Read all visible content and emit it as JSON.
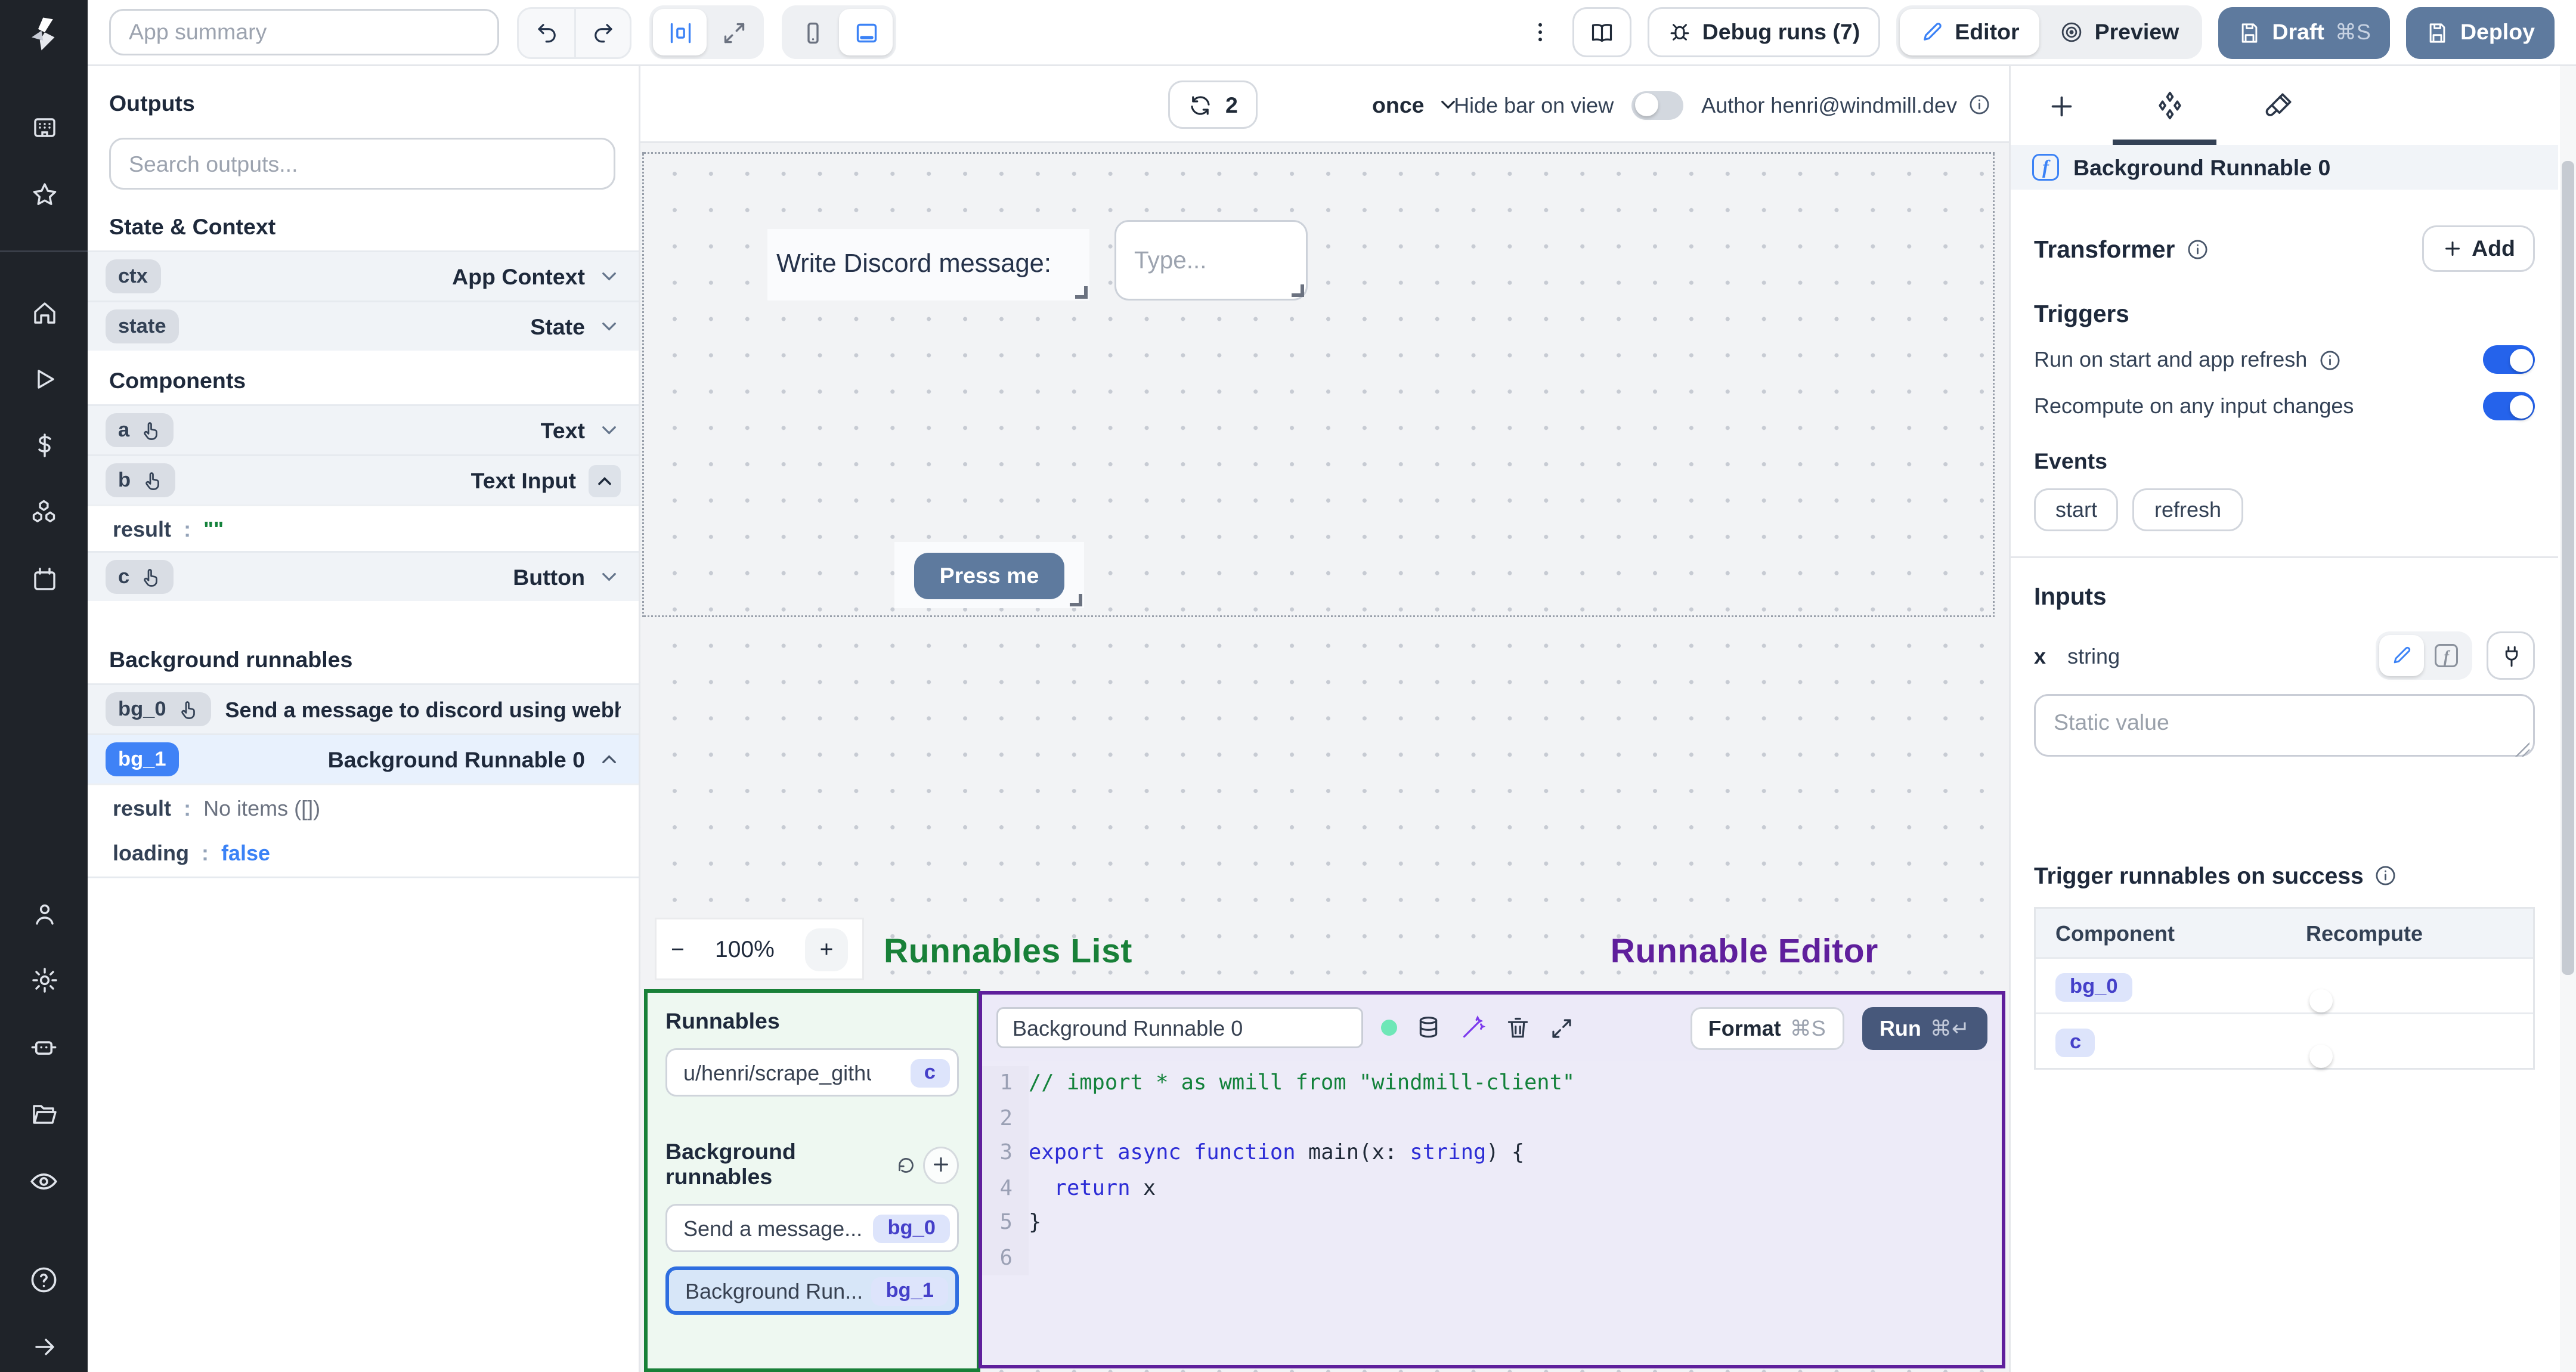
{
  "colors": {
    "accent-blue": "#3b82f6",
    "toggle-on": "#2563eb",
    "slate-btn": "#5e7a9e",
    "run-btn": "#47587b",
    "annotation-green": "#188038",
    "annotation-purple": "#5f1f9c",
    "badge-indigo-text": "#4540c9",
    "code-keyword": "#2d2dd6",
    "code-comment": "#13823b"
  },
  "topbar": {
    "app_summary_placeholder": "App summary",
    "debug_runs_label": "Debug runs (7)",
    "editor_label": "Editor",
    "preview_label": "Preview",
    "draft_label": "Draft",
    "draft_shortcut": "⌘S",
    "deploy_label": "Deploy"
  },
  "canvas_toolbar": {
    "refresh_count": "2",
    "frequency": "once",
    "hide_bar_label": "Hide bar on view",
    "author_label": "Author henri@windmill.dev"
  },
  "outputs": {
    "title": "Outputs",
    "search_placeholder": "Search outputs...",
    "state_context_title": "State & Context",
    "ctx": {
      "key": "ctx",
      "type": "App Context"
    },
    "state": {
      "key": "state",
      "type": "State"
    },
    "components_title": "Components",
    "comp_a": {
      "key": "a",
      "type": "Text"
    },
    "comp_b": {
      "key": "b",
      "type": "Text Input"
    },
    "b_result_key": "result",
    "b_result_value": "\"\"",
    "comp_c": {
      "key": "c",
      "type": "Button"
    },
    "background_title": "Background runnables",
    "bg0": {
      "key": "bg_0",
      "label": "Send a message to discord using webhoo"
    },
    "bg1": {
      "key": "bg_1",
      "label": "Background Runnable 0"
    },
    "bg1_result_key": "result",
    "bg1_result_value": "No items ([])",
    "bg1_loading_key": "loading",
    "bg1_loading_value": "false"
  },
  "canvas": {
    "text_component": "Write Discord message:",
    "input_placeholder": "Type...",
    "button_label": "Press me",
    "zoom_value": "100%",
    "zoom_out": "−",
    "zoom_in": "+"
  },
  "annotations": {
    "runnables_list": "Runnables List",
    "runnable_editor": "Runnable Editor"
  },
  "runnables_panel": {
    "title": "Runnables",
    "script_item": {
      "label": "u/henri/scrape_githu...",
      "badge": "c"
    },
    "background_title": "Background runnables",
    "item_bg0": {
      "label": "Send a message...",
      "badge": "bg_0"
    },
    "item_bg1": {
      "label": "Background Run...",
      "badge": "bg_1"
    }
  },
  "editor": {
    "name_value": "Background Runnable 0",
    "format_label": "Format",
    "format_shortcut": "⌘S",
    "run_label": "Run",
    "run_shortcut": "⌘↵",
    "code_lines": [
      [
        [
          "// import * as wmill from \"windmill-client\"",
          "com"
        ]
      ],
      [],
      [
        [
          "export",
          "kw"
        ],
        [
          " ",
          "pl"
        ],
        [
          "async",
          "kw"
        ],
        [
          " ",
          "pl"
        ],
        [
          "function",
          "kw"
        ],
        [
          " ",
          "pl"
        ],
        [
          "main",
          "pl"
        ],
        [
          "(x: ",
          "pl"
        ],
        [
          "string",
          "kw"
        ],
        [
          ") {",
          "pl"
        ]
      ],
      [
        [
          "  ",
          "pl"
        ],
        [
          "return",
          "kw"
        ],
        [
          " x",
          "pl"
        ]
      ],
      [
        [
          "}",
          "pl"
        ]
      ],
      []
    ]
  },
  "inspector": {
    "selected_title": "Background Runnable 0",
    "transformer_title": "Transformer",
    "add_label": "Add",
    "triggers_title": "Triggers",
    "run_on_start_label": "Run on start and app refresh",
    "recompute_label": "Recompute on any input changes",
    "events_title": "Events",
    "event_chips": [
      "start",
      "refresh"
    ],
    "inputs_title": "Inputs",
    "input_name": "x",
    "input_type": "string",
    "static_placeholder": "Static value",
    "trigger_success_title": "Trigger runnables on success",
    "table": {
      "headers": [
        "Component",
        "Recompute"
      ],
      "rows": [
        {
          "component": "bg_0",
          "recompute": "off"
        },
        {
          "component": "c",
          "recompute": "off"
        }
      ]
    }
  }
}
